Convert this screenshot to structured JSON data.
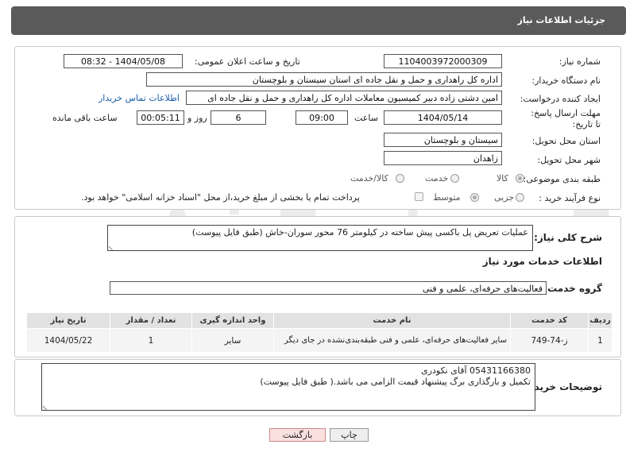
{
  "header": {
    "title": "جزئیات اطلاعات نیاز"
  },
  "fields": {
    "need_number_label": "شماره نیاز:",
    "need_number": "1104003972000309",
    "announce_label": "تاریخ و ساعت اعلان عمومی:",
    "announce_value": "1404/05/08 - 08:32",
    "buyer_org_label": "نام دستگاه خریدار:",
    "buyer_org": "اداره کل راهداری و حمل و نقل جاده ای استان سیستان و بلوچستان",
    "creator_label": "ایجاد کننده درخواست:",
    "creator": "امین دشتی زاده دبیر کمیسیون معاملات اداره کل راهداری و حمل و نقل جاده ای",
    "contact_link": "اطلاعات تماس خریدار",
    "deadline_label": "مهلت ارسال پاسخ: تا تاریخ:",
    "deadline_date": "1404/05/14",
    "time_label": "ساعت",
    "deadline_time": "09:00",
    "days_value": "6",
    "days_label": "روز و",
    "remaining_time": "00:05:11",
    "remaining_label": "ساعت باقی مانده",
    "province_label": "استان محل تحویل:",
    "province": "سیستان و بلوچستان",
    "city_label": "شهر محل تحویل:",
    "city": "زاهدان",
    "category_label": "طبقه بندی موضوعی:",
    "category_options": [
      "کالا",
      "خدمت",
      "کالا/خدمت"
    ],
    "process_label": "نوع فرآیند خرید :",
    "process_options": [
      "جزیی",
      "متوسط"
    ],
    "payment_note": "پرداخت تمام یا بخشی از مبلغ خرید،از محل \"اسناد خزانه اسلامی\" خواهد بود."
  },
  "summary": {
    "label": "شرح کلی نیاز:",
    "text": "عملیات تعریض پل باکسی پیش ساخته در کیلومتر 76 محور سوران-خاش (طبق فایل پیوست)"
  },
  "services": {
    "title": "اطلاعات خدمات مورد نیاز",
    "group_label": "گروه خدمت:",
    "group_value": "فعالیت‌های حرفه‌ای، علمی و فنی",
    "columns": [
      "ردیف",
      "کد خدمت",
      "نام خدمت",
      "واحد اندازه گیری",
      "تعداد / مقدار",
      "تاریخ نیاز"
    ],
    "rows": [
      [
        "1",
        "ز-74-749",
        "سایر فعالیت‌های حرفه‌ای، علمی و فنی طبقه‌بندی‌نشده در جای دیگر",
        "سایر",
        "1",
        "1404/05/22"
      ]
    ]
  },
  "buyer_notes": {
    "label": "توضیحات خریدار:",
    "line1": "05431166380 آقای نکودری",
    "line2": "تکمیل و بارگذاری برگ پیشنهاد قیمت الزامی می باشد.( طبق فایل پیوست)"
  },
  "buttons": {
    "print": "چاپ",
    "back": "بازگشت"
  }
}
